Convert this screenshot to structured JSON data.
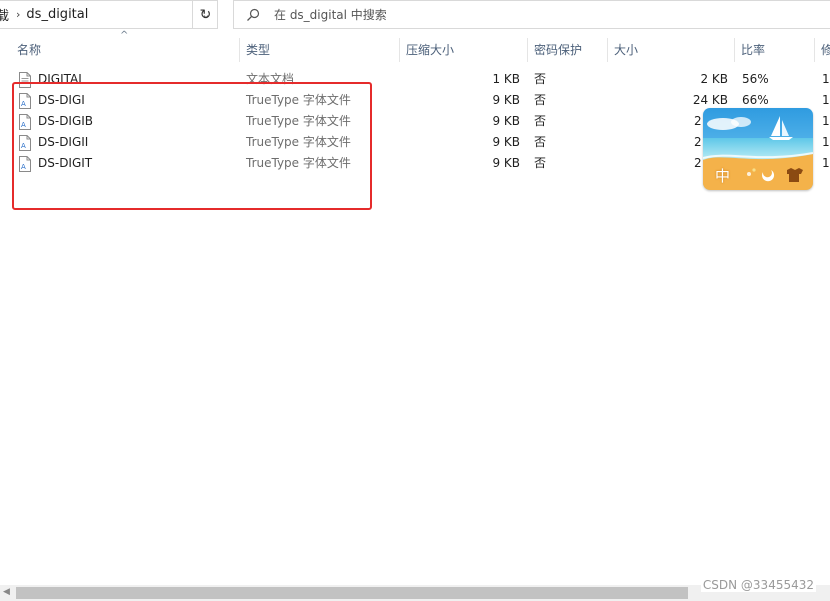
{
  "address_bar": {
    "prev_crumb": "载",
    "current_folder": "ds_digital"
  },
  "search": {
    "placeholder": "在 ds_digital 中搜索"
  },
  "columns": {
    "name": "名称",
    "type": "类型",
    "compressed_size": "压缩大小",
    "password": "密码保护",
    "size": "大小",
    "ratio": "比率",
    "modified": "修"
  },
  "files": [
    {
      "name": "DIGITAL",
      "type": "文本文档",
      "compressed": "1 KB",
      "password": "否",
      "size": "2 KB",
      "ratio": "56%",
      "modified": "1",
      "icon": "text-file-icon"
    },
    {
      "name": "DS-DIGI",
      "type": "TrueType 字体文件",
      "compressed": "9 KB",
      "password": "否",
      "size": "24 KB",
      "ratio": "66%",
      "modified": "1",
      "icon": "font-file-icon"
    },
    {
      "name": "DS-DIGIB",
      "type": "TrueType 字体文件",
      "compressed": "9 KB",
      "password": "否",
      "size": "2",
      "ratio": "",
      "modified": "1",
      "icon": "font-file-icon"
    },
    {
      "name": "DS-DIGII",
      "type": "TrueType 字体文件",
      "compressed": "9 KB",
      "password": "否",
      "size": "2",
      "ratio": "",
      "modified": "1",
      "icon": "font-file-icon"
    },
    {
      "name": "DS-DIGIT",
      "type": "TrueType 字体文件",
      "compressed": "9 KB",
      "password": "否",
      "size": "2",
      "ratio": "",
      "modified": "1",
      "icon": "font-file-icon"
    }
  ],
  "ime": {
    "mode_char": "中"
  },
  "watermark": "CSDN @33455432",
  "colors": {
    "highlight_border": "#e52b2b",
    "header_text": "#4c607a",
    "ime_sky": "#2f9be0",
    "ime_sand": "#f4b24a"
  }
}
